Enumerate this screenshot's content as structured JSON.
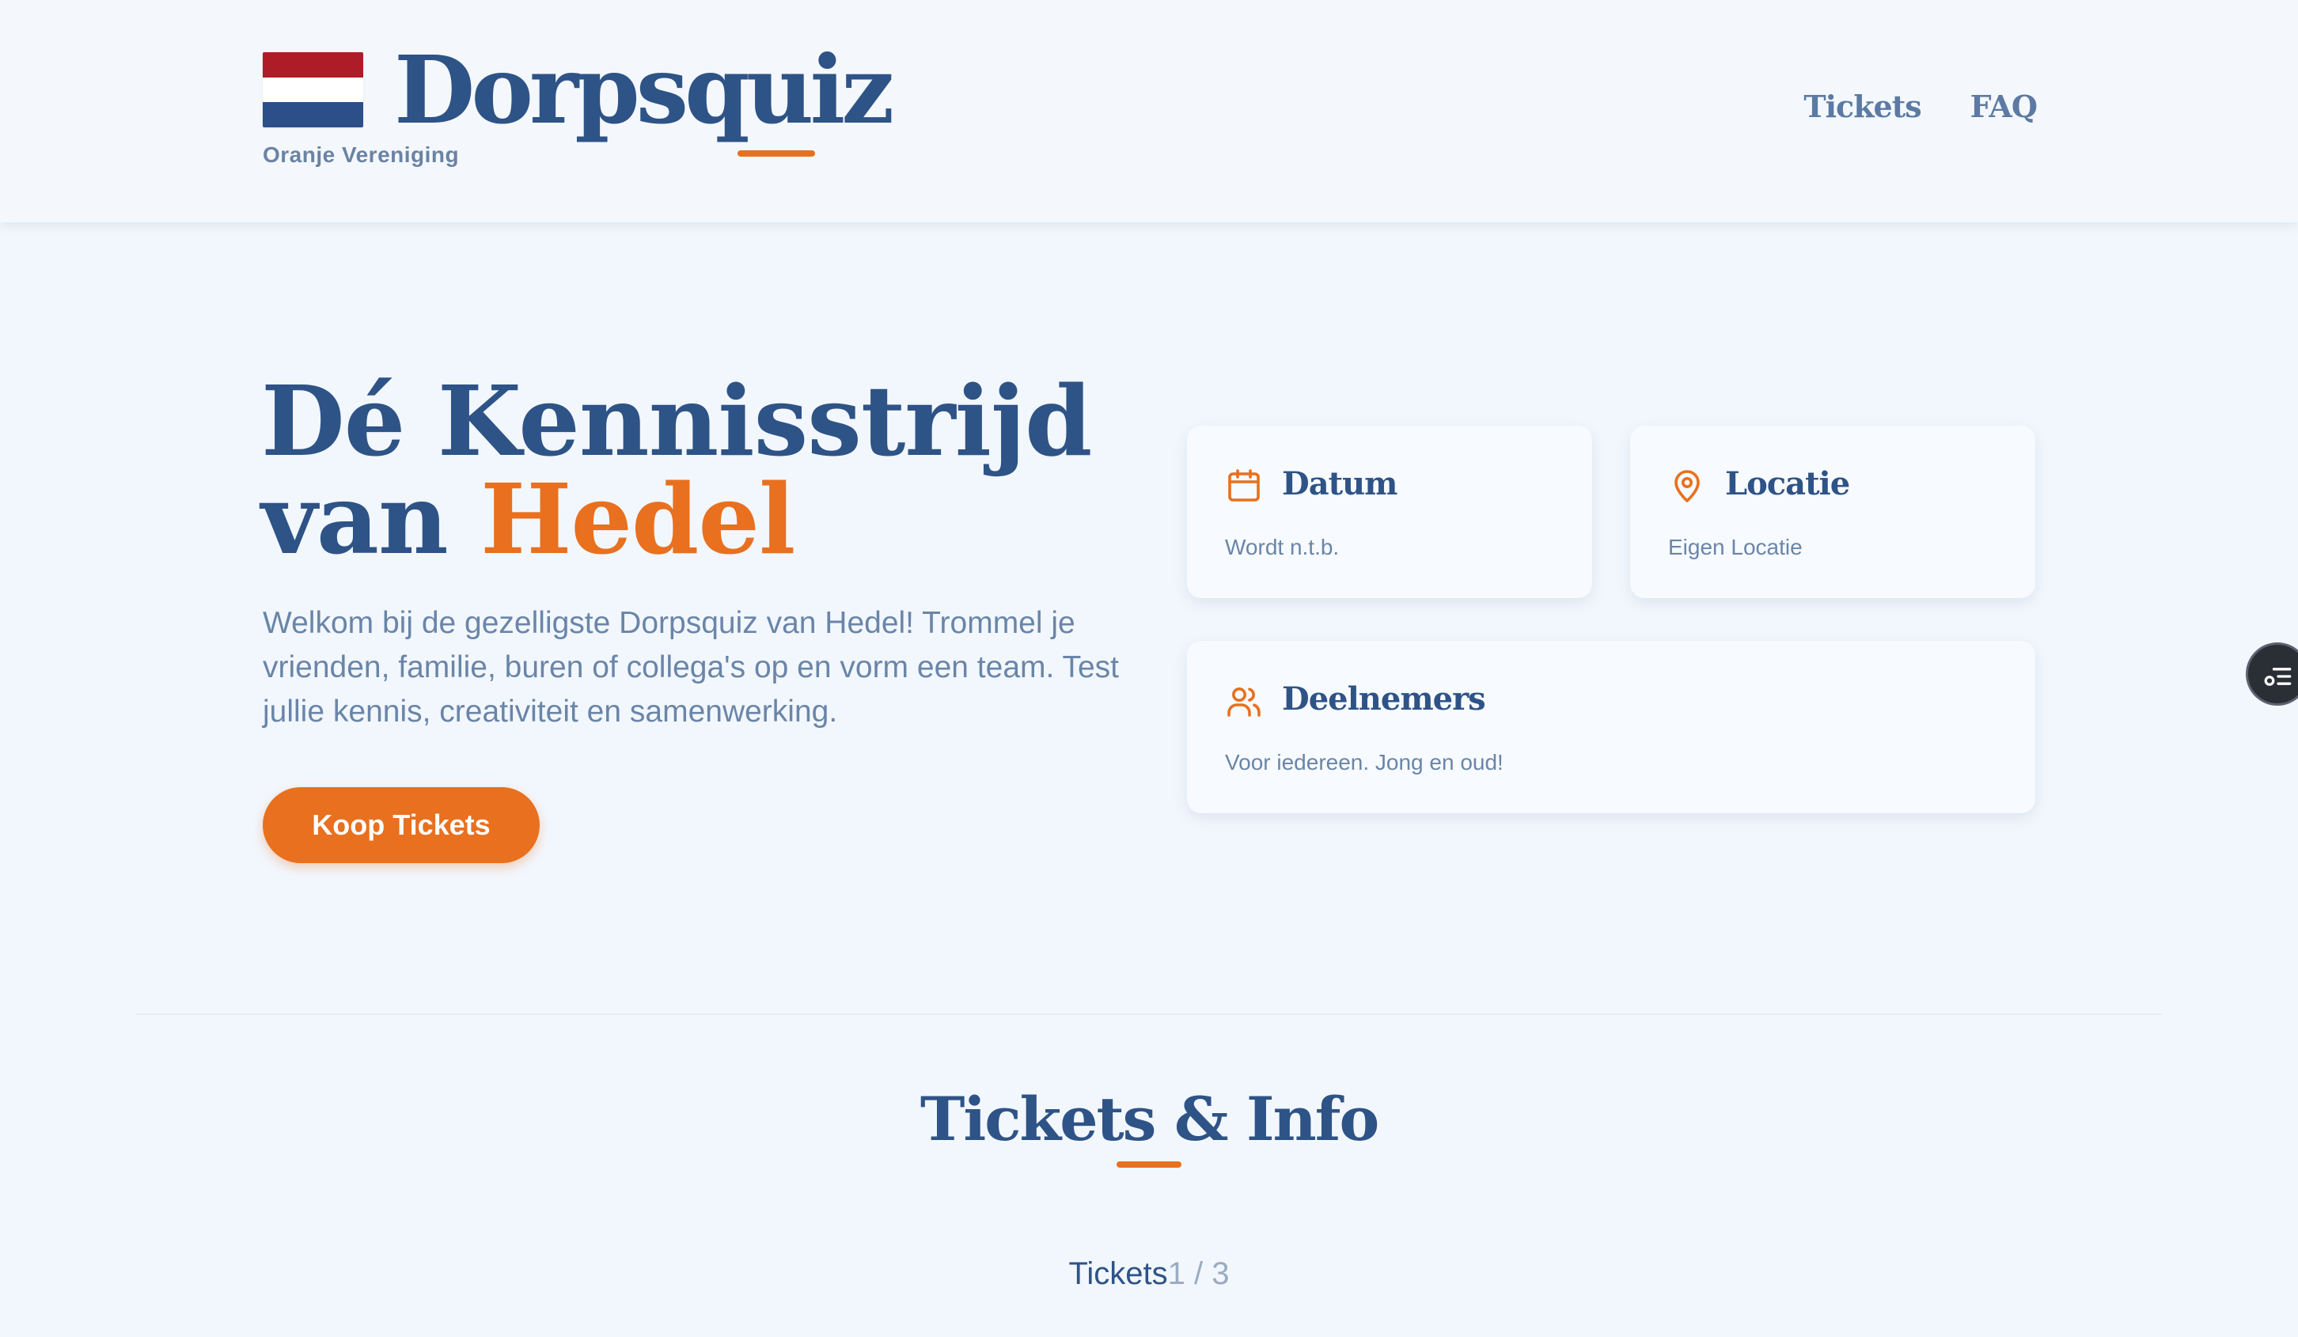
{
  "header": {
    "brand": "Dorpsquiz",
    "org": "Oranje Vereniging",
    "nav": [
      {
        "label": "Tickets"
      },
      {
        "label": "FAQ"
      }
    ]
  },
  "hero": {
    "title_line1": "Dé Kennisstrijd",
    "title_line2_prefix": "van ",
    "title_line2_accent": "Hedel",
    "text": "Welkom bij de gezelligste Dorpsquiz van Hedel! Trommel je vrienden, familie, buren of collega's op en vorm een team. Test jullie kennis, creativiteit en samenwerking.",
    "cta_label": "Koop Tickets"
  },
  "cards": [
    {
      "icon": "calendar-icon",
      "title": "Datum",
      "desc": "Wordt n.t.b."
    },
    {
      "icon": "map-pin-icon",
      "title": "Locatie",
      "desc": "Eigen Locatie"
    },
    {
      "icon": "users-icon",
      "title": "Deelnemers",
      "desc": "Voor iedereen. Jong en oud!"
    }
  ],
  "section": {
    "title": "Tickets & Info",
    "tickets_label": "Tickets",
    "tickets_count": "1 / 3"
  },
  "colors": {
    "primary": "#2e5386",
    "accent": "#e8701f",
    "background": "#f2f7fd"
  }
}
